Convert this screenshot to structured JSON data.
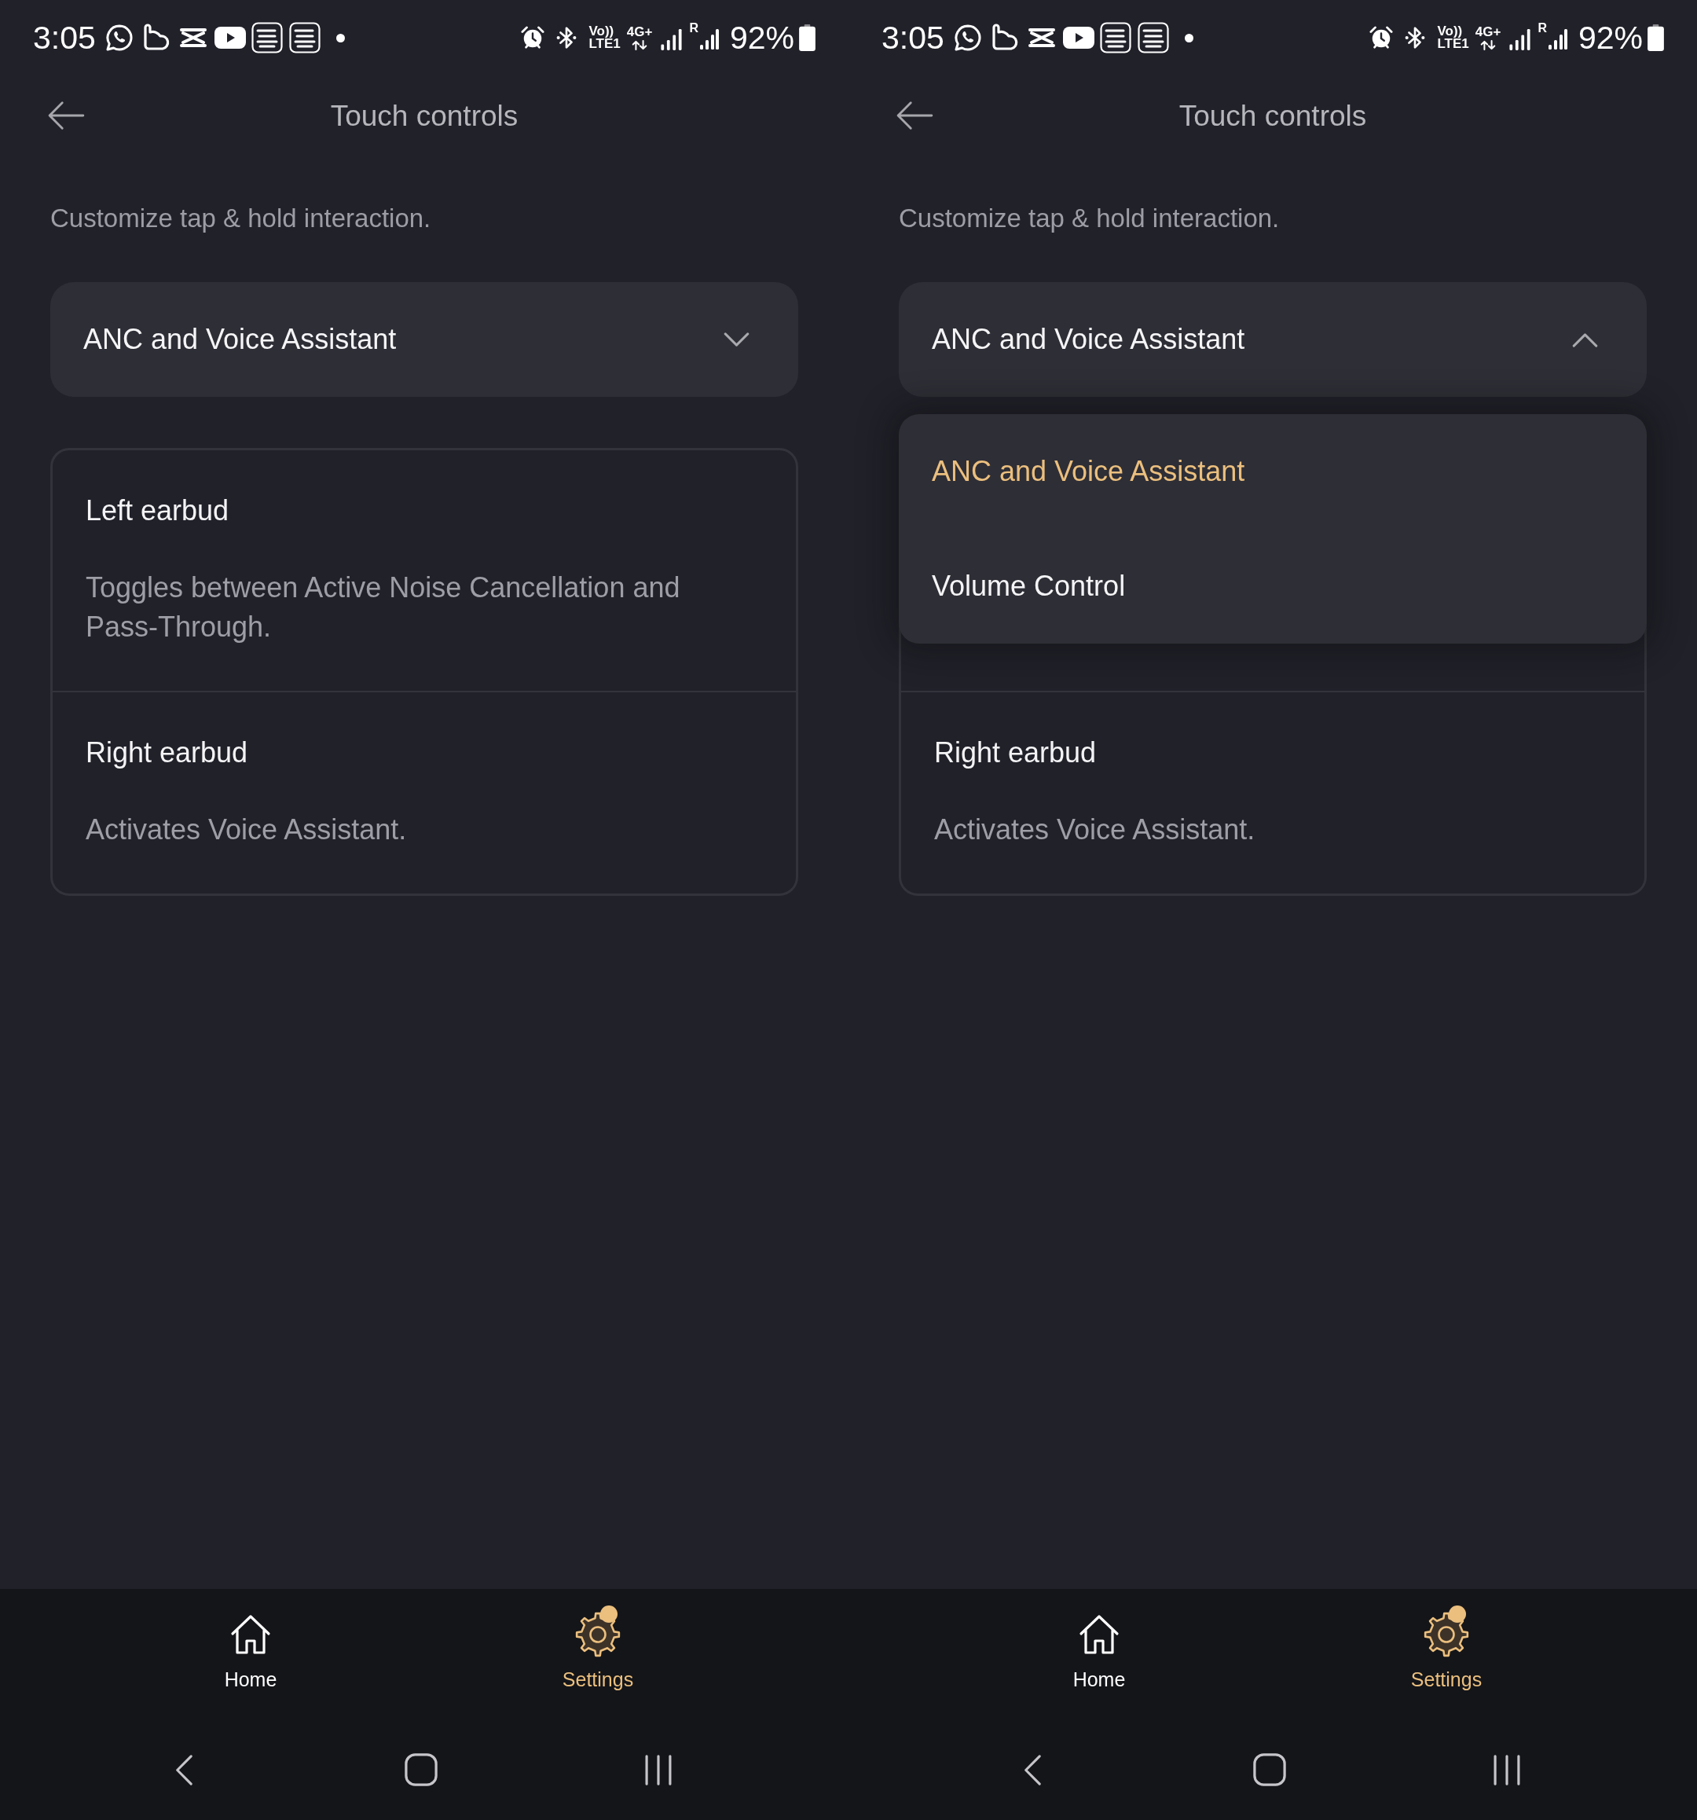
{
  "screens": [
    {
      "status_bar": {
        "time": "3:05",
        "volte_top": "Vo))",
        "volte_bottom": "LTE1",
        "data_type": "4G+",
        "roaming": "R",
        "battery": "92%"
      },
      "header": {
        "title": "Touch controls"
      },
      "subtitle": "Customize tap & hold interaction.",
      "dropdown": {
        "value": "ANC and Voice Assistant",
        "expanded": false
      },
      "card": {
        "sections": [
          {
            "title": "Left earbud",
            "description": "Toggles between Active Noise Cancellation and Pass-Through."
          },
          {
            "title": "Right earbud",
            "description": "Activates Voice Assistant."
          }
        ]
      },
      "bottom_nav": [
        {
          "kind": "home",
          "label": "Home",
          "selected": false,
          "dot": false
        },
        {
          "kind": "settings",
          "label": "Settings",
          "selected": true,
          "dot": true
        }
      ]
    },
    {
      "status_bar": {
        "time": "3:05",
        "volte_top": "Vo))",
        "volte_bottom": "LTE1",
        "data_type": "4G+",
        "roaming": "R",
        "battery": "92%"
      },
      "header": {
        "title": "Touch controls"
      },
      "subtitle": "Customize tap & hold interaction.",
      "dropdown": {
        "value": "ANC and Voice Assistant",
        "expanded": true,
        "options": [
          {
            "label": "ANC and Voice Assistant",
            "selected": true
          },
          {
            "label": "Volume Control",
            "selected": false
          }
        ]
      },
      "card": {
        "sections": [
          {
            "title": "Right earbud",
            "description": "Activates Voice Assistant."
          }
        ]
      },
      "bottom_nav": [
        {
          "kind": "home",
          "label": "Home",
          "selected": false,
          "dot": false
        },
        {
          "kind": "settings",
          "label": "Settings",
          "selected": true,
          "dot": true
        }
      ]
    }
  ]
}
